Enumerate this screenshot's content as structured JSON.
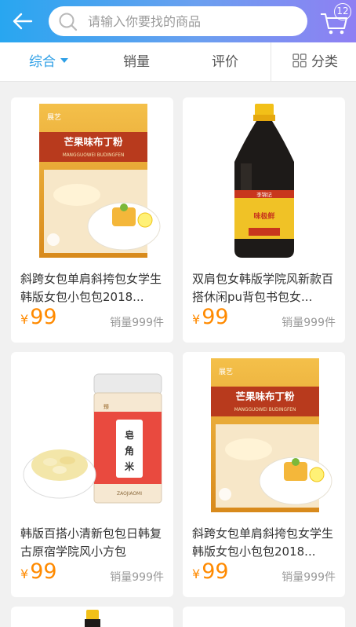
{
  "header": {
    "search_placeholder": "请输入你要找的商品",
    "cart_badge": "12"
  },
  "tabs": [
    {
      "label": "综合",
      "active": true
    },
    {
      "label": "销量",
      "active": false
    },
    {
      "label": "评价",
      "active": false
    },
    {
      "label": "分类",
      "active": false
    }
  ],
  "products": [
    {
      "title": "斜跨女包单肩斜挎包女学生韩版女包小包包2018...",
      "price_symbol": "¥",
      "price": "99",
      "sales": "销量999件",
      "image_icon": "jelly-pudding-box",
      "package_brand": "展艺",
      "package_name": "芒果味布丁粉",
      "package_pinyin": "MANGGUOWEI BUDINGFEN"
    },
    {
      "title": "双肩包女韩版学院风新款百搭休闲pu背包书包女...",
      "price_symbol": "¥",
      "price": "99",
      "sales": "销量999件",
      "image_icon": "soy-sauce-bottle",
      "package_brand": "李锦记",
      "package_name": "味极鲜"
    },
    {
      "title": "韩版百搭小清新包包日韩复古原宿学院风小方包",
      "price_symbol": "¥",
      "price": "99",
      "sales": "销量999件",
      "image_icon": "soap-seed-jar",
      "package_brand": "臻",
      "package_name": "皂角米",
      "package_pinyin": "ZAOJIAOMI"
    },
    {
      "title": "斜跨女包单肩斜挎包女学生韩版女包小包包2018...",
      "price_symbol": "¥",
      "price": "99",
      "sales": "销量999件",
      "image_icon": "jelly-pudding-box",
      "package_brand": "展艺",
      "package_name": "芒果味布丁粉",
      "package_pinyin": "MANGGUOWEI BUDINGFEN"
    }
  ],
  "colors": {
    "accent": "#2e9fe6",
    "price": "#ff8a00",
    "header_start": "#28a6f0",
    "header_end": "#8f7ff3"
  }
}
